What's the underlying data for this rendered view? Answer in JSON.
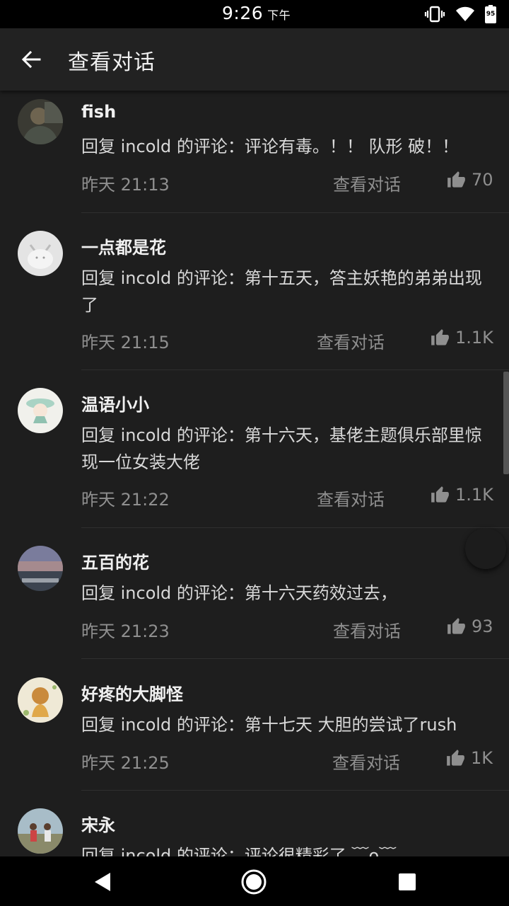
{
  "status_bar": {
    "time": "9:26",
    "ampm": "下午",
    "battery": "95"
  },
  "header": {
    "title": "查看对话"
  },
  "comments": [
    {
      "username": "fish",
      "content": "回复 incold 的评论：评论有毒。！！ 队形 破！！",
      "time": "昨天 21:13",
      "view_label": "查看对话",
      "likes": "70"
    },
    {
      "username": "一点都是花",
      "content": "回复 incold 的评论：第十五天，答主妖艳的弟弟出现了",
      "time": "昨天 21:15",
      "view_label": "查看对话",
      "likes": "1.1K"
    },
    {
      "username": "温语小小",
      "content": "回复 incold 的评论：第十六天，基佬主题俱乐部里惊现一位女装大佬",
      "time": "昨天 21:22",
      "view_label": "查看对话",
      "likes": "1.1K"
    },
    {
      "username": "五百的花",
      "content": "回复 incold 的评论：第十六天药效过去，",
      "time": "昨天 21:23",
      "view_label": "查看对话",
      "likes": "93"
    },
    {
      "username": "好疼的大脚怪",
      "content": "回复 incold 的评论：第十七天 大胆的尝试了rush",
      "time": "昨天 21:25",
      "view_label": "查看对话",
      "likes": "1K"
    },
    {
      "username": "宋永",
      "content": "回复 incold 的评论：评论很精彩了 ﹋o﹋"
    }
  ]
}
